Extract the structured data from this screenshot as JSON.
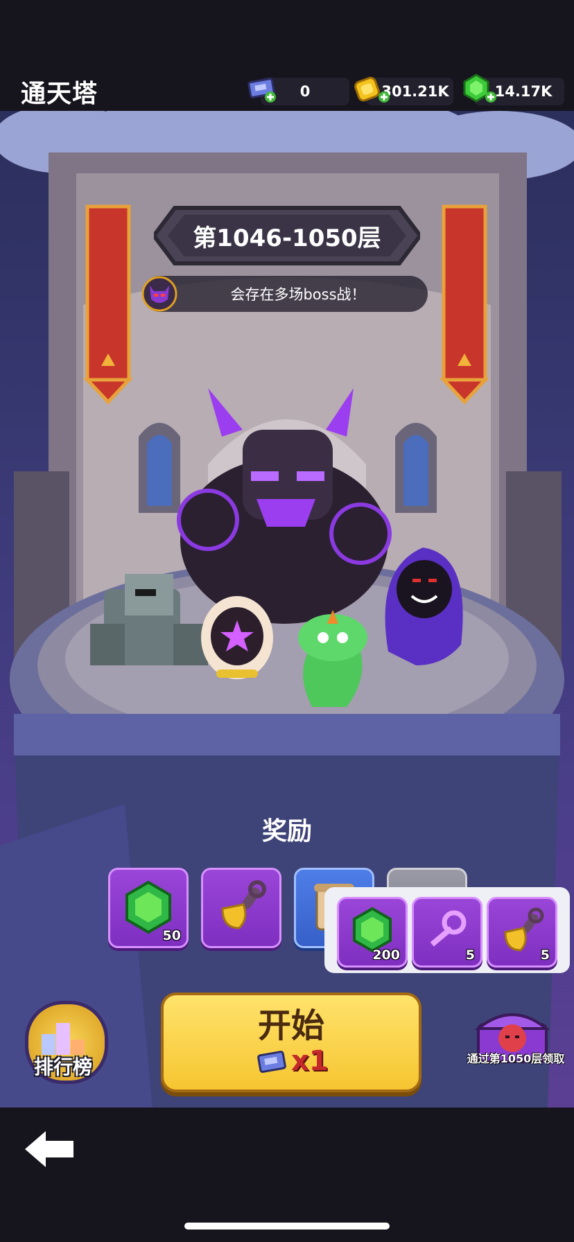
{
  "header": {
    "title": "通天塔",
    "tickets": "0",
    "gold": "301.21K",
    "gems": "14.17K"
  },
  "floor": {
    "range": "第1046-1050层",
    "boss_notice": "会存在多场boss战！"
  },
  "rewards": {
    "title": "奖励",
    "items": [
      {
        "icon": "green-gem-icon",
        "count": "50"
      },
      {
        "icon": "shovel-icon",
        "count": ""
      },
      {
        "icon": "scroll-icon",
        "count": ""
      },
      {
        "icon": "locked-item-icon",
        "count": ""
      }
    ]
  },
  "popup": {
    "items": [
      {
        "icon": "green-gem-icon",
        "count": "200"
      },
      {
        "icon": "purple-key-icon",
        "count": "5"
      },
      {
        "icon": "shovel-icon",
        "count": "5"
      }
    ]
  },
  "actions": {
    "start_label": "开始",
    "start_cost": "x1",
    "leaderboard_label": "排行榜",
    "chest_label": "通过第1050层领取"
  },
  "colors": {
    "accent_purple": "#8a3ad0",
    "button_yellow": "#f6c531",
    "cost_red": "#c42a2a"
  }
}
